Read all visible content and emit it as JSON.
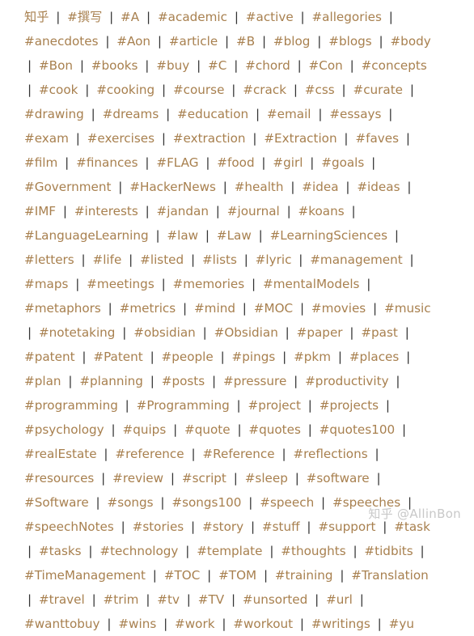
{
  "tags": [
    "知乎",
    "#撰写",
    "#A",
    "#academic",
    "#active",
    "#allegories",
    "#anecdotes",
    "#Aon",
    "#article",
    "#B",
    "#blog",
    "#blogs",
    "#body",
    "#Bon",
    "#books",
    "#buy",
    "#C",
    "#chord",
    "#Con",
    "#concepts",
    "#cook",
    "#cooking",
    "#course",
    "#crack",
    "#css",
    "#curate",
    "#drawing",
    "#dreams",
    "#education",
    "#email",
    "#essays",
    "#exam",
    "#exercises",
    "#extraction",
    "#Extraction",
    "#faves",
    "#film",
    "#finances",
    "#FLAG",
    "#food",
    "#girl",
    "#goals",
    "#Government",
    "#HackerNews",
    "#health",
    "#idea",
    "#ideas",
    "#IMF",
    "#interests",
    "#jandan",
    "#journal",
    "#koans",
    "#LanguageLearning",
    "#law",
    "#Law",
    "#LearningSciences",
    "#letters",
    "#life",
    "#listed",
    "#lists",
    "#lyric",
    "#management",
    "#maps",
    "#meetings",
    "#memories",
    "#mentalModels",
    "#metaphors",
    "#metrics",
    "#mind",
    "#MOC",
    "#movies",
    "#music",
    "#notetaking",
    "#obsidian",
    "#Obsidian",
    "#paper",
    "#past",
    "#patent",
    "#Patent",
    "#people",
    "#pings",
    "#pkm",
    "#places",
    "#plan",
    "#planning",
    "#posts",
    "#pressure",
    "#productivity",
    "#programming",
    "#Programming",
    "#project",
    "#projects",
    "#psychology",
    "#quips",
    "#quote",
    "#quotes",
    "#quotes100",
    "#realEstate",
    "#reference",
    "#Reference",
    "#reflections",
    "#resources",
    "#review",
    "#script",
    "#sleep",
    "#software",
    "#Software",
    "#songs",
    "#songs100",
    "#speech",
    "#speeches",
    "#speechNotes",
    "#stories",
    "#story",
    "#stuff",
    "#support",
    "#task",
    "#tasks",
    "#technology",
    "#template",
    "#thoughts",
    "#tidbits",
    "#TimeManagement",
    "#TOC",
    "#TOM",
    "#training",
    "#Translation",
    "#travel",
    "#trim",
    "#tv",
    "#TV",
    "#unsorted",
    "#url",
    "#wanttobuy",
    "#wins",
    "#work",
    "#workout",
    "#writings",
    "#yu"
  ],
  "separator": "|",
  "watermark": "知乎 @AllinBon",
  "colors": {
    "tag": "#a8804f",
    "separator": "#333333",
    "watermark": "#c8c8c8",
    "background": "#ffffff"
  }
}
